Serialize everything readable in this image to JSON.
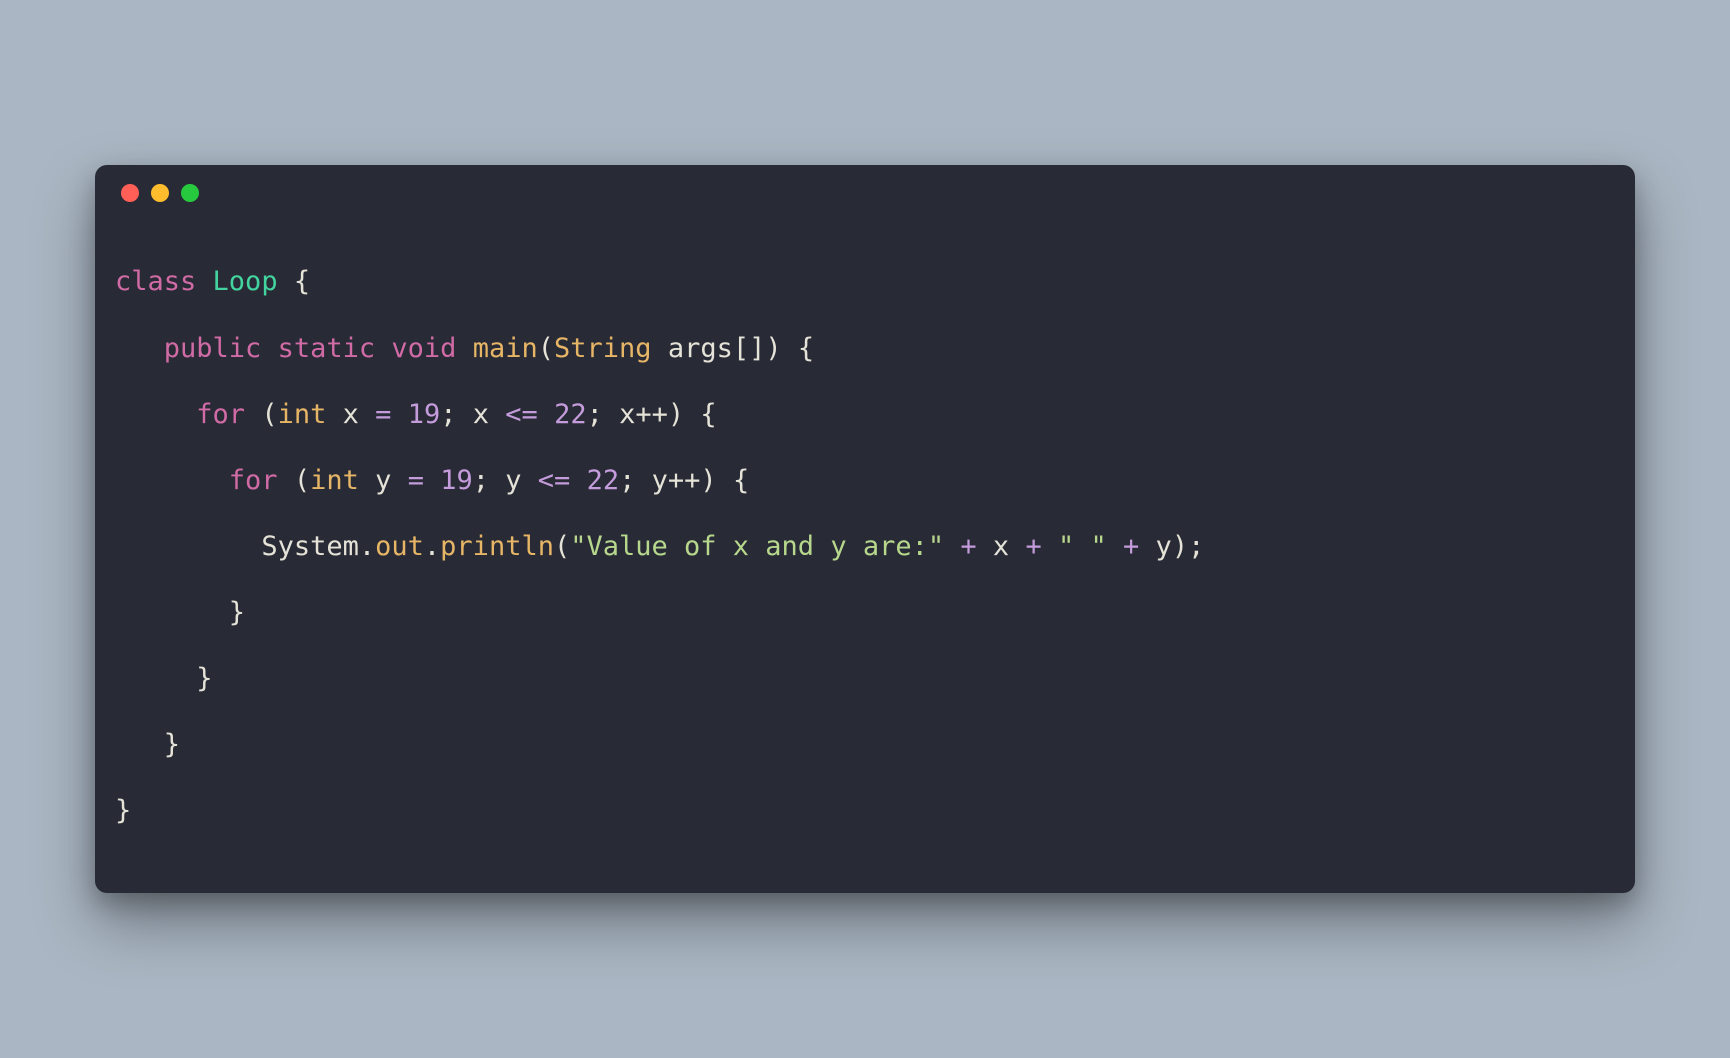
{
  "colors": {
    "background_page": "#aab6c3",
    "window_bg": "#282a36",
    "dot_red": "#ff5f56",
    "dot_yellow": "#ffbd2e",
    "dot_green": "#27c93f",
    "text_default": "#e5e3d8",
    "keyword": "#d16ba5",
    "classname": "#43d39e",
    "type_func": "#e6b566",
    "number_op": "#c49cdc",
    "string": "#b7d88c"
  },
  "code_language": "java",
  "tokens": {
    "kw_class": "class",
    "cls_name": "Loop",
    "kw_public": "public",
    "kw_static": "static",
    "kw_void": "void",
    "fn_main": "main",
    "ty_string": "String",
    "var_args": "args",
    "kw_for1": "for",
    "ty_int1": "int",
    "var_x": "x",
    "num_19a": "19",
    "op_le1": "<=",
    "num_22a": "22",
    "inc_x": "x++",
    "kw_for2": "for",
    "ty_int2": "int",
    "var_y": "y",
    "num_19b": "19",
    "op_le2": "<=",
    "num_22b": "22",
    "inc_y": "y++",
    "obj_system": "System",
    "obj_out": "out",
    "fn_println": "println",
    "str_msg": "\"Value of x and y are:\"",
    "str_space": "\" \"",
    "op_plus1": "+",
    "op_plus2": "+",
    "op_plus3": "+",
    "op_eq1": "=",
    "op_eq2": "=",
    "brace_open": "{",
    "brace_close": "}",
    "paren_open": "(",
    "paren_close": ")",
    "bracket_pair": "[]",
    "semicolon": ";",
    "dot": "."
  }
}
